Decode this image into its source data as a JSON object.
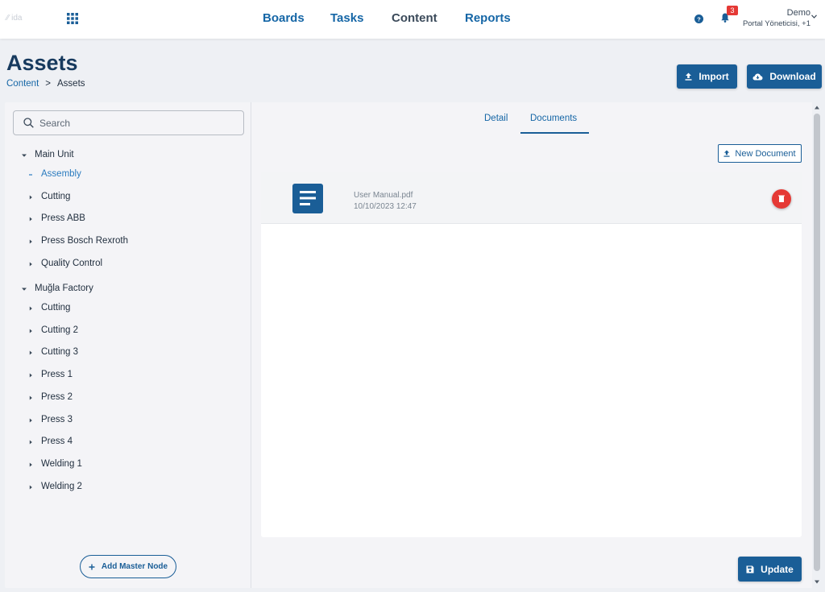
{
  "app": {
    "logo_text": "ida"
  },
  "nav": {
    "items": [
      {
        "label": "Boards"
      },
      {
        "label": "Tasks"
      },
      {
        "label": "Content"
      },
      {
        "label": "Reports"
      }
    ]
  },
  "user": {
    "notifications_count": "3",
    "name": "Demo",
    "role": "Portal Yöneticisi, +1"
  },
  "header": {
    "title": "Assets",
    "breadcrumb": {
      "parent": "Content",
      "separator": ">",
      "current": "Assets"
    },
    "import_label": "Import",
    "download_label": "Download"
  },
  "sidebar": {
    "search_placeholder": "Search",
    "groups": [
      {
        "label": "Main Unit",
        "children": [
          "Assembly",
          "Cutting",
          "Press ABB",
          "Press Bosch Rexroth",
          "Quality Control"
        ]
      },
      {
        "label": "Muğla Factory",
        "children": [
          "Cutting",
          "Cutting 2",
          "Cutting 3",
          "Press 1",
          "Press 2",
          "Press 3",
          "Press 4",
          "Welding 1",
          "Welding 2"
        ]
      }
    ],
    "selected": "Assembly",
    "add_master_label": "Add Master Node"
  },
  "content": {
    "tabs": [
      {
        "label": "Detail"
      },
      {
        "label": "Documents"
      }
    ],
    "active_tab": "Documents",
    "new_document_label": "New Document",
    "documents": [
      {
        "name": "User Manual.pdf",
        "date": "10/10/2023 12:47"
      }
    ],
    "update_label": "Update"
  },
  "colors": {
    "primary": "#1a5e97",
    "link": "#1566a6",
    "danger": "#e53935",
    "title": "#173a5e"
  }
}
